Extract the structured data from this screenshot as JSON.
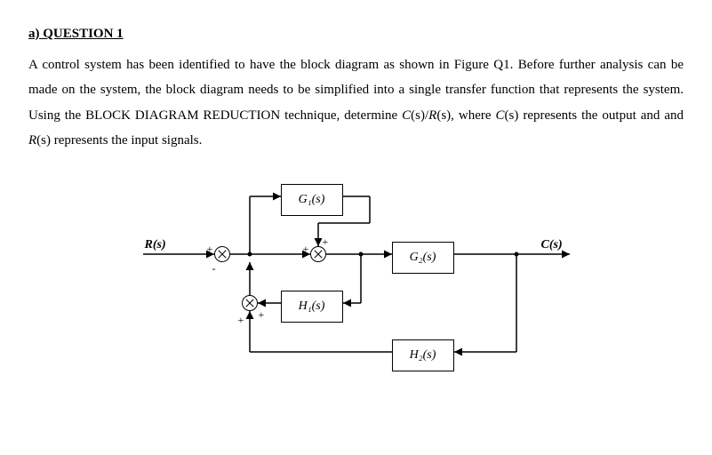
{
  "heading": "a) QUESTION 1",
  "paragraph_parts": {
    "p1": "A control system has been identified to have the block diagram as shown in Figure Q1. Before further analysis can be made on the system, the block diagram needs to be simplified into a single transfer function that represents the system. Using the BLOCK DIAGRAM REDUCTION technique, determine ",
    "ratio_C": "C",
    "ratio_s": "(s)",
    "slash": "/",
    "ratio_R": "R",
    "p2": ", where ",
    "C": "C",
    "p3": " represents the output and and ",
    "R": "R",
    "p4": " represents the input signals."
  },
  "diagram": {
    "input_label": "R(s)",
    "output_label": "C(s)",
    "G1": "G₁(s)",
    "G2": "G₂(s)",
    "H1": "H₁(s)",
    "H2": "H₂(s)",
    "plus": "+",
    "minus": "-"
  }
}
